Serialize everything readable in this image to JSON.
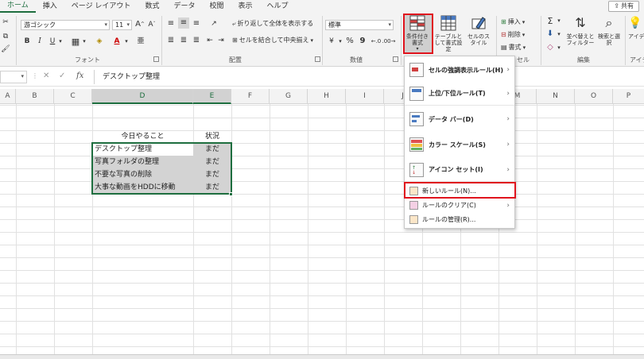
{
  "tabs": [
    "ホーム",
    "挿入",
    "ページ レイアウト",
    "数式",
    "データ",
    "校閲",
    "表示",
    "ヘルプ"
  ],
  "share_label": "共有",
  "ribbon": {
    "font_name": "游ゴシック",
    "font_size": "11",
    "font_group": "フォント",
    "wrap_text": "折り返して全体を表示する",
    "merge_center": "セルを結合して中央揃え",
    "alignment_group": "配置",
    "number_format": "標準",
    "number_group": "数値",
    "percent_symbol": "%",
    "comma_symbol": "9",
    "conditional_format": "条件付き書式",
    "format_as_table": "テーブルとして書式設定",
    "cell_styles": "セルのスタイル",
    "insert": "挿入",
    "delete": "削除",
    "format": "書式",
    "cells_group": "セル",
    "sort_filter": "並べ替えとフィルター",
    "find_select": "検索と選択",
    "editing_group": "編集",
    "ideas": "アイデ",
    "ideas_group": "アイデア"
  },
  "formula_bar": {
    "content": "デスクトップ整理"
  },
  "columns": [
    "A",
    "B",
    "C",
    "D",
    "E",
    "F",
    "G",
    "H",
    "I",
    "J",
    "K",
    "L",
    "M",
    "N",
    "O",
    "P"
  ],
  "table": {
    "header_task": "今日やること",
    "header_status": "状況",
    "rows": [
      {
        "task": "デスクトップ整理",
        "status": "まだ"
      },
      {
        "task": "写真フォルダの整理",
        "status": "まだ"
      },
      {
        "task": "不要な写真の削除",
        "status": "まだ"
      },
      {
        "task": "大事な動画をHDDに移動",
        "status": "まだ"
      }
    ]
  },
  "dropdown": {
    "items": [
      {
        "label": "セルの強調表示ルール(H)"
      },
      {
        "label": "上位/下位ルール(T)"
      },
      {
        "label": "データ バー(D)"
      },
      {
        "label": "カラー スケール(S)"
      },
      {
        "label": "アイコン セット(I)"
      },
      {
        "label": "新しいルール(N)..."
      },
      {
        "label": "ルールのクリア(C)"
      },
      {
        "label": "ルールの管理(R)..."
      }
    ]
  },
  "colors": {
    "accent": "#1e6e3f",
    "highlight_red": "#e0141e",
    "selection_fill": "#d3d3d3"
  }
}
